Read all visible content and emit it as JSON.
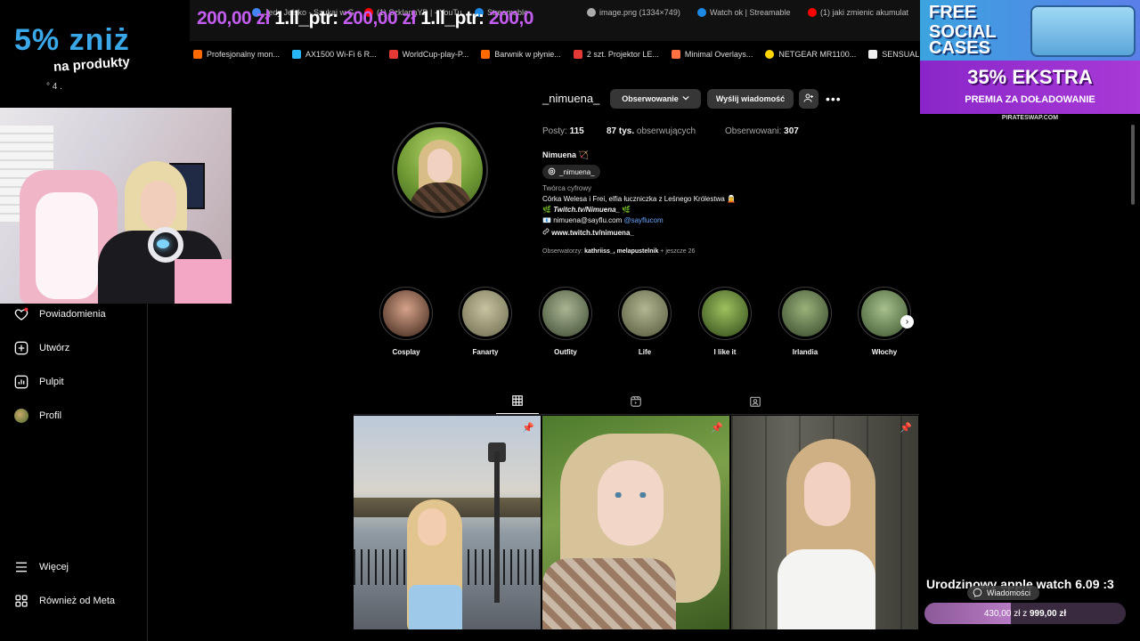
{
  "browser": {
    "tabs": [
      {
        "label": "Jedy Jelsko - Szukaj w G",
        "color": "#4285f4"
      },
      {
        "label": "(1) SzklanaYB | - YouTu",
        "color": "#ff0000"
      },
      {
        "label": "Streamable",
        "color": "#1e88e5"
      },
      {
        "label": "image.png (1334×749)",
        "color": "#aaaaaa"
      },
      {
        "label": "Watch ok | Streamable",
        "color": "#1e88e5"
      },
      {
        "label": "(1) jaki zmienic akumulat",
        "color": "#ff0000"
      }
    ],
    "ticker": {
      "amount": "200,00 zł",
      "label": "1.ll_ptr:",
      "amount2": "200,00 zł",
      "label2": "1.ll_ptr:",
      "amount3": "200,0"
    }
  },
  "bookmarks": [
    {
      "label": "Profesjonalny mon...",
      "color": "#ff6a00"
    },
    {
      "label": "AX1500 Wi-Fi 6 R...",
      "color": "#29b6f6"
    },
    {
      "label": "WorldCup-play-P...",
      "color": "#e53935"
    },
    {
      "label": "Barwnik w płynie...",
      "color": "#ff6a00"
    },
    {
      "label": "2 szt. Projektor LE...",
      "color": "#e53935"
    },
    {
      "label": "Minimal Overlays...",
      "color": "#ff7043"
    },
    {
      "label": "NETGEAR MR1100...",
      "color": "#ffd600"
    },
    {
      "label": "SENSUAL VANILL...",
      "color": "#eeeeee"
    }
  ],
  "promo_left": {
    "big": "5% zniż",
    "small": "na produkty",
    "dots": "° 4 ."
  },
  "leftnav": [
    {
      "label": "Powiadomienia",
      "icon": "heart-icon"
    },
    {
      "label": "Utwórz",
      "icon": "plus-square-icon"
    },
    {
      "label": "Pulpit",
      "icon": "chart-icon"
    },
    {
      "label": "Profil",
      "icon": "avatar-icon"
    },
    {
      "label": "Więcej",
      "icon": "hamburger-icon"
    },
    {
      "label": "Również od Meta",
      "icon": "meta-grid-icon"
    }
  ],
  "profile": {
    "username": "_nimuena_",
    "follow_label": "Obserwowanie",
    "message_label": "Wyślij wiadomość",
    "stats": {
      "posts_label": "Posty:",
      "posts_value": "115",
      "followers_value": "87 tys.",
      "followers_label": "obserwujących",
      "following_label": "Obserwowani:",
      "following_value": "307"
    },
    "full_name": "Nimuena 🏹",
    "threads_handle": "_nimuena_",
    "category": "Twórca cyfrowy",
    "bio_line1": "Córka Welesa i Frei, elfia łuczniczka z Leśnego Królestwa 🧝",
    "bio_line2_icon": "🌿",
    "bio_line2": "Twitch.tv/Nimuena_",
    "bio_line2_end": "🌿",
    "bio_line3_icon": "📧",
    "bio_line3": "nimuena@sayflu.com",
    "bio_line3_link": "@sayflucom",
    "bio_line4": "www.twitch.tv/nimuena_",
    "followed_by_prefix": "Obserwatorzy:",
    "followed_by_names": "kathriiss_, melapustelnik",
    "followed_by_more": "+ jeszcze 26"
  },
  "highlights": [
    {
      "label": "Cosplay",
      "c1": "#d6a38a",
      "c2": "#3b2418"
    },
    {
      "label": "Fanarty",
      "c1": "#c7c3a1",
      "c2": "#6c6b4d"
    },
    {
      "label": "Outfity",
      "c1": "#a9b592",
      "c2": "#3d4a32"
    },
    {
      "label": "Life",
      "c1": "#b3b692",
      "c2": "#54573b"
    },
    {
      "label": "I like it",
      "c1": "#9fc05e",
      "c2": "#2f4a1a"
    },
    {
      "label": "Irlandia",
      "c1": "#9bb27a",
      "c2": "#34462a"
    },
    {
      "label": "Włochy",
      "c1": "#a7c08b",
      "c2": "#3c5530"
    }
  ],
  "promo_right": {
    "line1": "FREE",
    "line2": "SOCIAL",
    "line3": "CASES",
    "bonus": "35% EKSTRA",
    "bonus_sub": "PREMIA ZA DOŁADOWANIE",
    "footer": "PIRATESWAP.COM"
  },
  "goal": {
    "title": "Urodzinowy apple watch 6.09 :3",
    "messages_label": "Wiadomości",
    "current": "430,00 zł",
    "separator": "z",
    "target": "999,00 zł",
    "progress": 0.43
  }
}
